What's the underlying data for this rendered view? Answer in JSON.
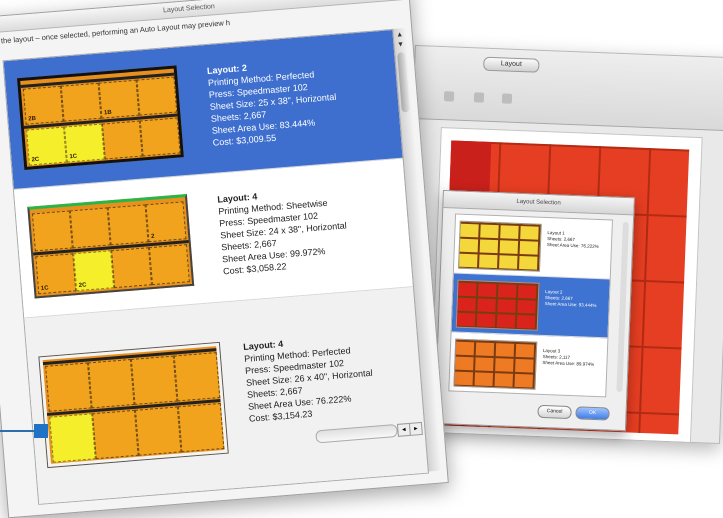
{
  "main_dialog": {
    "title": "Layout Selection",
    "description": "the layout – once selected, performing an Auto Layout may preview h",
    "layouts": [
      {
        "title": "Layout: 2",
        "printing_method": "Printing Method: Perfected",
        "press": "Press: Speedmaster 102",
        "sheet_size": "Sheet Size: 25 x 38\", Horizontal",
        "sheets": "Sheets: 2,667",
        "area_use": "Sheet Area Use: 83.444%",
        "cost": "Cost: $3,009.55",
        "selected": true
      },
      {
        "title": "Layout: 4",
        "printing_method": "Printing Method: Sheetwise",
        "press": "Press: Speedmaster 102",
        "sheet_size": "Sheet Size: 24 x 38\", Horizontal",
        "sheets": "Sheets: 2,667",
        "area_use": "Sheet Area Use: 99.972%",
        "cost": "Cost: $3,058.22",
        "selected": false
      },
      {
        "title": "Layout: 4",
        "printing_method": "Printing Method: Perfected",
        "press": "Press: Speedmaster 102",
        "sheet_size": "Sheet Size: 26 x 40\", Horizontal",
        "sheets": "Sheets: 2,667",
        "area_use": "Sheet Area Use: 76.222%",
        "cost": "Cost: $3,154.23",
        "selected": false
      }
    ],
    "thumb_labels": {
      "a": "1",
      "b": "2",
      "c": "2C",
      "d": "1C",
      "e": "2B",
      "f": "1B",
      "g": "1C",
      "h": "2C"
    }
  },
  "background_window": {
    "tab_label": "Layout",
    "colors": {
      "sheet": "#e63e22",
      "toolbar": "#d9d9d9"
    }
  },
  "small_dialog": {
    "title": "Layout Selection",
    "items": [
      {
        "line1": "Layout 1",
        "line2": "Sheets: 2,667",
        "line3": "Sheet Area Use: 76.222%"
      },
      {
        "line1": "Layout 2",
        "line2": "Sheets: 2,667",
        "line3": "Sheet Area Use: 93.444%"
      },
      {
        "line1": "Layout 3",
        "line2": "Sheets: 2,117",
        "line3": "Sheet Area Use: 89.974%"
      }
    ],
    "cancel_label": "Cancel",
    "ok_label": "OK"
  },
  "colors": {
    "selection_blue": "#3e6fcf",
    "orange_cell": "#f2a31d",
    "yellow_cell": "#f5ee2a",
    "callout": "#1e73c6"
  }
}
